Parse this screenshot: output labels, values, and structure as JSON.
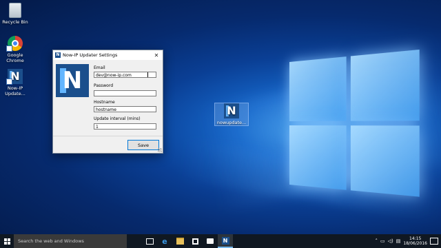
{
  "desktop": {
    "icons": [
      {
        "label": "Recycle Bin"
      },
      {
        "label": "Google Chrome"
      },
      {
        "label": "Now-IP Update..."
      },
      {
        "label": "nowupdate..."
      }
    ]
  },
  "dialog": {
    "title": "Now-IP Updater Settings",
    "close_label": "✕",
    "email": {
      "label": "Email",
      "value": "dev@now-ip.com"
    },
    "password": {
      "label": "Password",
      "value": ""
    },
    "hostname": {
      "label": "Hostname",
      "value": "hostname"
    },
    "interval": {
      "label": "Update interval (mins)",
      "value": "1"
    },
    "save_label": "Save"
  },
  "taskbar": {
    "search_placeholder": "Search the web and Windows",
    "time": "14:15",
    "date": "18/06/2016"
  },
  "colors": {
    "accent": "#0078d7",
    "brand": "#1b4f8c"
  }
}
